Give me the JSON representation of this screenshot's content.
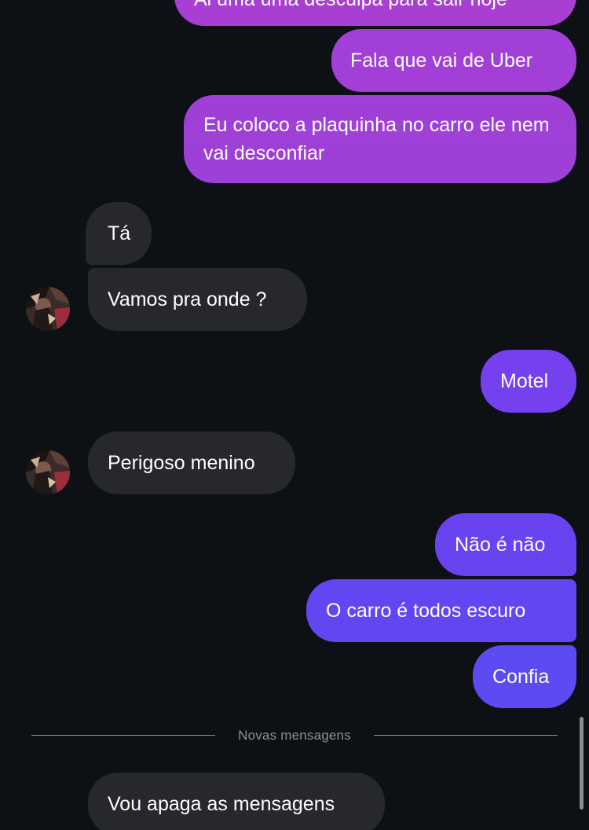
{
  "messages": {
    "top_partial": "Ai uma uma desculpa para sair hoje",
    "m1": "Fala que vai de Uber",
    "m2": "Eu coloco a plaquinha no carro ele nem vai desconfiar",
    "m3": "Tá",
    "m4": "Vamos pra onde ?",
    "m5": "Motel",
    "m6": "Perigoso menino",
    "m7": "Não é não",
    "m8": "O carro é todos escuro",
    "m9": "Confia",
    "m10": "Vou apaga as mensagens"
  },
  "divider": {
    "label": "Novas mensagens"
  },
  "colors": {
    "background": "#0d1014",
    "received_bubble": "#26282c",
    "sent_purple_top": "#a23fd4",
    "sent_violet_mid": "#7540ee",
    "sent_blue_bottom": "#5d4bf2"
  }
}
